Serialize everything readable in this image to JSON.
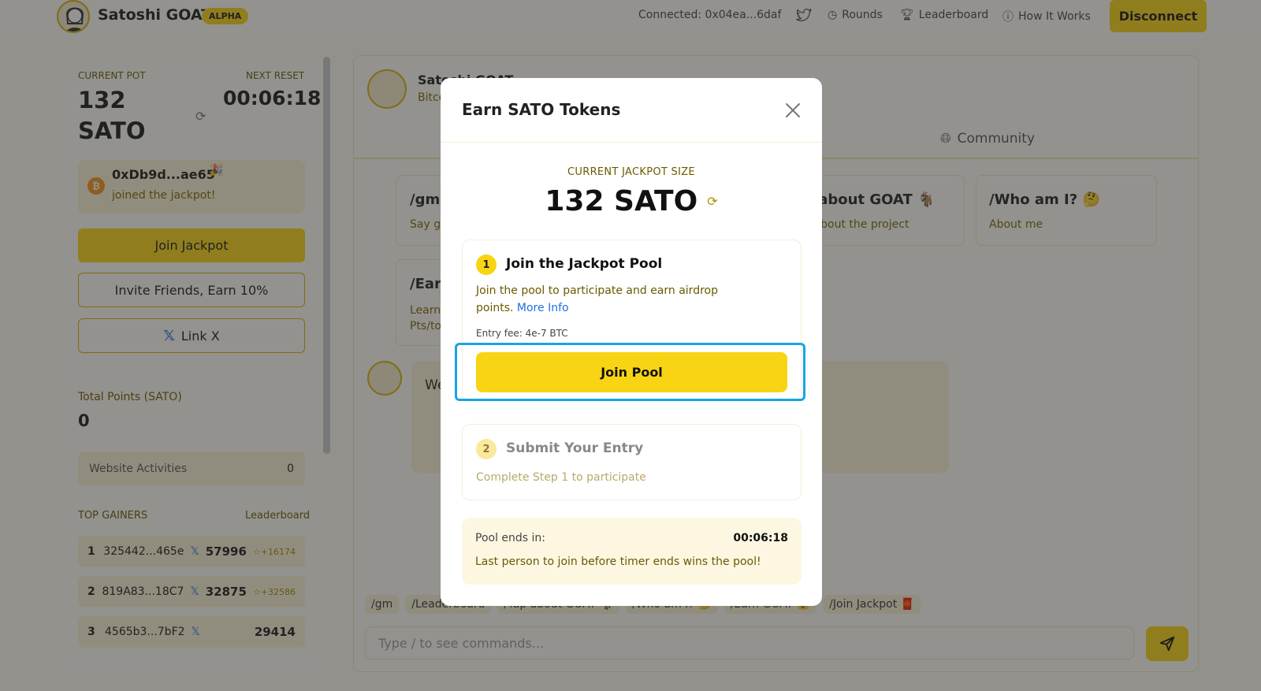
{
  "header": {
    "brand": "Satoshi GOAT",
    "badge": "ALPHA",
    "connected": "Connected:  0x04ea...6daf",
    "nav": [
      "Rounds",
      "Leaderboard",
      "How It Works"
    ],
    "disconnect": "Disconnect"
  },
  "sidebar": {
    "current_pot_label": "CURRENT POT",
    "current_pot": "132 SATO",
    "next_reset_label": "NEXT RESET",
    "next_reset": "00:06:18",
    "joined_address": "0xDb9d...ae65",
    "joined_text": "joined the jackpot!",
    "join_jackpot": "Join Jackpot",
    "invite": "Invite Friends, Earn 10%",
    "link_x": "Link X",
    "total_points_label": "Total Points (SATO)",
    "total_points": "0",
    "website_activities": "Website Activities",
    "website_activities_value": "0",
    "top_gainers_label": "TOP GAINERS",
    "leaderboard_link": "Leaderboard",
    "gainers": [
      {
        "rank": "1",
        "address": "325442...465e",
        "score": "57996",
        "delta": "+16174"
      },
      {
        "rank": "2",
        "address": "819A83...18C7",
        "score": "32875",
        "delta": "+32586"
      },
      {
        "rank": "3",
        "address": "4565b3...7bF2",
        "score": "29414",
        "delta": ""
      }
    ]
  },
  "chat": {
    "bot_name": "Satoshi GOAT",
    "bot_sub": "Bitcoin",
    "community_tab": "Community",
    "commands": [
      {
        "title": "/gm",
        "sub": "Say gm"
      },
      {
        "title": "/Yap about GOAT 🐐",
        "sub": "Learn about the project"
      },
      {
        "title": "/Who am I? 🤔",
        "sub": "About me"
      },
      {
        "title": "/Earn",
        "sub": "Learn how to earn SATO Pts/tokens"
      }
    ],
    "message_text": "Welcome! Start chatting and earning rewards",
    "chips": [
      "/gm",
      "/Leaderboard",
      "/Yap about GOAT 🐐",
      "/Who am I? 🤔",
      "/Earn GOAT 💰",
      "/Join Jackpot 🧧"
    ],
    "input_placeholder": "Type / to see commands..."
  },
  "modal": {
    "title": "Earn SATO Tokens",
    "jackpot_label": "CURRENT JACKPOT SIZE",
    "jackpot_value": "132 SATO",
    "step1": {
      "number": "1",
      "title": "Join the Jackpot Pool",
      "desc": "Join the pool to participate and earn airdrop points.",
      "more_info": "More Info",
      "entry_fee": "Entry fee: 4e-7 BTC",
      "button": "Join Pool"
    },
    "step2": {
      "number": "2",
      "title": "Submit Your Entry",
      "desc": "Complete Step 1 to participate"
    },
    "pool_ends_label": "Pool ends in:",
    "pool_ends_timer": "00:06:18",
    "pool_note": "Last person to join before timer ends wins the pool!"
  }
}
